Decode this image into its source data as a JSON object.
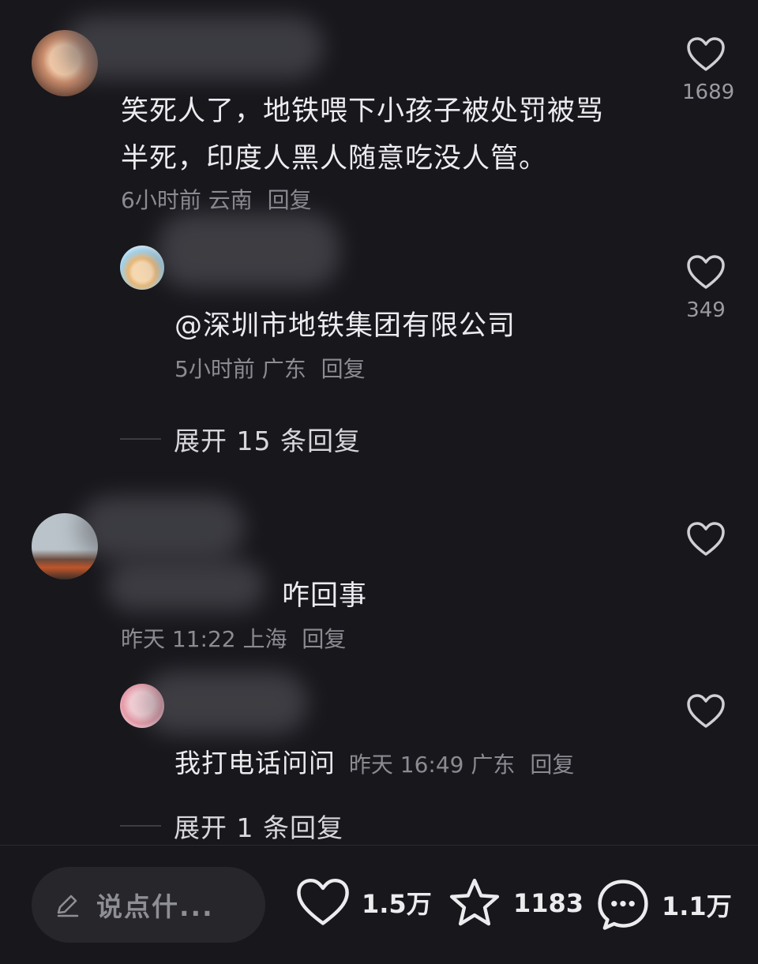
{
  "comments": [
    {
      "text_line1": "笑死人了，地铁喂下小孩子被处罚被骂",
      "text_line2": "半死，印度人黑人随意吃没人管。",
      "time": "6小时前",
      "location": "云南",
      "reply_label": "回复",
      "likes": "1689",
      "replies": [
        {
          "text": "@深圳市地铁集团有限公司",
          "time": "5小时前",
          "location": "广东",
          "reply_label": "回复",
          "likes": "349"
        }
      ],
      "expand_label": "展开 15 条回复"
    },
    {
      "text": "咋回事",
      "time": "昨天 11:22",
      "location": "上海",
      "reply_label": "回复",
      "likes": "",
      "replies": [
        {
          "text": "我打电话问问",
          "time": "昨天 16:49",
          "location": "广东",
          "reply_label": "回复",
          "likes": ""
        }
      ],
      "expand_label": "展开 1 条回复"
    }
  ],
  "bottom_bar": {
    "input_placeholder": "说点什...",
    "like_count": "1.5万",
    "favorite_count": "1183",
    "comment_count": "1.1万"
  },
  "icons": [
    "heart-icon",
    "pencil-icon",
    "star-icon",
    "comment-bubble-icon"
  ],
  "colors": {
    "background": "#17171c",
    "text": "#ececef",
    "meta": "#8b8b92"
  }
}
